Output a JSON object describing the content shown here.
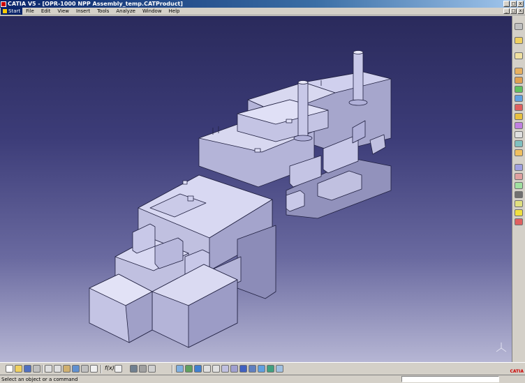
{
  "window": {
    "title": "CATIA V5 - [OPR-1000 NPP Assembly_temp.CATProduct]",
    "controls": [
      "_",
      "□",
      "x"
    ]
  },
  "menubar": {
    "items": [
      "Start",
      "File",
      "Edit",
      "View",
      "Insert",
      "Tools",
      "Analyze",
      "Window",
      "Help"
    ],
    "doc_controls": [
      "_",
      "□",
      "x"
    ]
  },
  "toolbar_bottom": {
    "formula_label": "f(x)"
  },
  "statusbar": {
    "message": "Select an object or a command",
    "command_value": ""
  },
  "brand": {
    "logo_text": "CATIA"
  },
  "colors": {
    "viewport_top": "#2a2a5c",
    "viewport_bottom": "#b6b6d4",
    "model_light": "#d0d0ee",
    "model_mid": "#b4b4d8",
    "model_dark": "#9292bc",
    "edge": "#202040"
  },
  "icons": {
    "right_toolbar": [
      "select-icon",
      "cursor-icon",
      "product-icon",
      "insert-component-icon",
      "replace-icon",
      "constraint-icon",
      "move-icon",
      "explode-icon",
      "clash-icon",
      "section-icon",
      "distance-icon",
      "snap-icon",
      "scene-icon",
      "annotation-icon",
      "weld-icon",
      "publish-icon",
      "tree-icon",
      "bill-icon",
      "bulb-icon",
      "delete-icon"
    ],
    "bottom_toolbar": [
      "new-icon",
      "open-icon",
      "save-icon",
      "print-icon",
      "cut-icon",
      "copy-icon",
      "paste-icon",
      "undo-icon",
      "redo-icon",
      "whats-this-icon",
      "formula-icon",
      "comment-icon",
      "catalog-icon",
      "bom-icon",
      "pan-icon",
      "fit-all-icon",
      "rotate-icon",
      "fly-icon",
      "zoom-in-icon",
      "zoom-out-icon",
      "normal-view-icon",
      "isometric-icon",
      "shading-icon",
      "hide-show-icon",
      "swap-icon",
      "render-icon",
      "material-icon"
    ]
  }
}
